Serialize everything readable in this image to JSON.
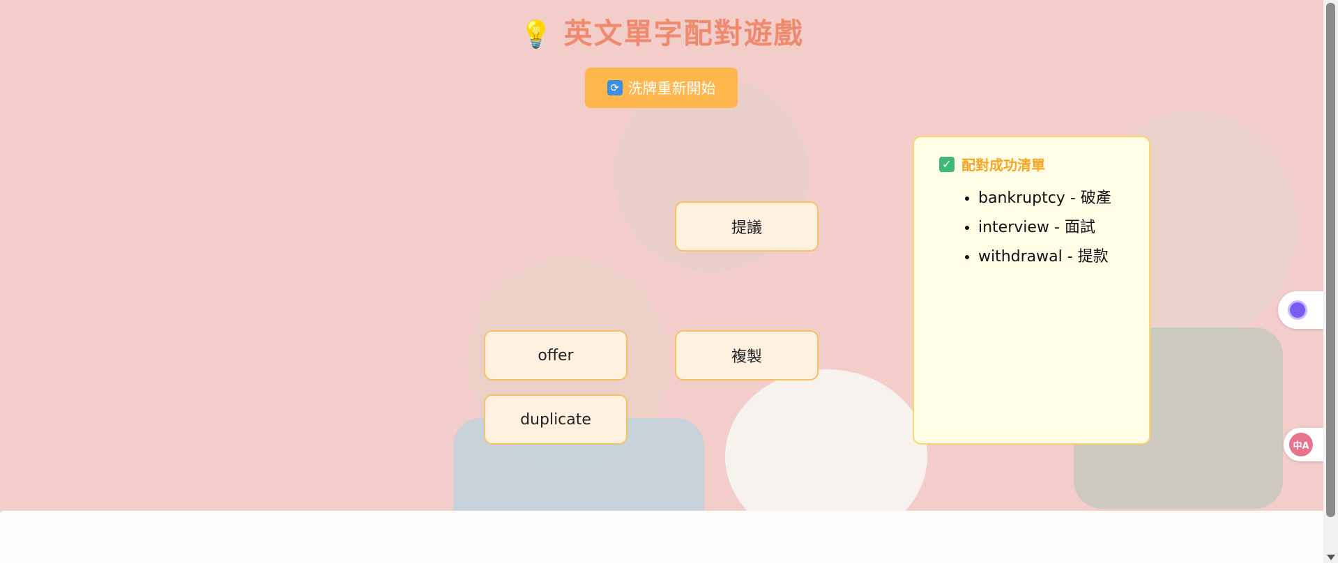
{
  "title": {
    "icon": "lightbulb-icon",
    "emoji": "💡",
    "text": "英文單字配對遊戲"
  },
  "shuffle_button": {
    "icon": "refresh-icon",
    "glyph": "🔄",
    "label": "洗牌重新開始"
  },
  "cards": [
    {
      "text": "提議"
    },
    {
      "text": "offer"
    },
    {
      "text": "複製"
    },
    {
      "text": "duplicate"
    }
  ],
  "matched_panel": {
    "icon": "checkmark-icon",
    "glyph": "✓",
    "title": "配對成功清單",
    "items": [
      "bankruptcy - 破產",
      "interview - 面試",
      "withdrawal - 提款"
    ]
  },
  "side_widgets": {
    "bug_icon": "bug-icon",
    "translate_icon": "translate-icon",
    "translate_glyph": "中A"
  },
  "colors": {
    "background": "#f2cdca",
    "title": "#f08a6e",
    "button": "#ffb74d",
    "card_bg": "#fff1e0",
    "card_border": "#f7c262",
    "panel_bg": "#fffde6",
    "panel_title": "#f5a623"
  }
}
